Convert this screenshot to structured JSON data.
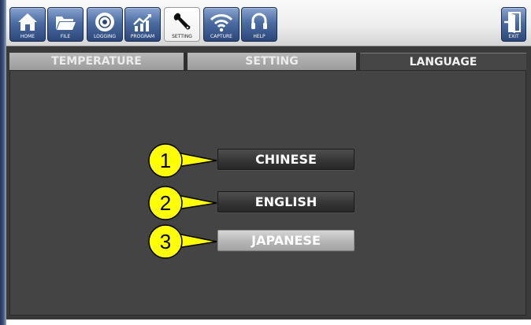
{
  "toolbar": {
    "buttons": [
      {
        "label": "HOME",
        "icon": "home-icon"
      },
      {
        "label": "FILE",
        "icon": "folder-icon"
      },
      {
        "label": "LOGGING",
        "icon": "disc-icon"
      },
      {
        "label": "PROGRAM",
        "icon": "chart-icon"
      },
      {
        "label": "SETTING",
        "icon": "wrench-icon",
        "active": true
      },
      {
        "label": "CAPTURE",
        "icon": "wifi-icon"
      },
      {
        "label": "HELP",
        "icon": "headset-icon"
      }
    ],
    "exit": {
      "label": "EXIT",
      "icon": "exit-door-icon"
    }
  },
  "tabs": [
    {
      "label": "TEMPERATURE",
      "selected": false
    },
    {
      "label": "SETTING",
      "selected": false
    },
    {
      "label": "LANGUAGE",
      "selected": true
    }
  ],
  "languages": [
    {
      "label": "CHINESE",
      "selected": false
    },
    {
      "label": "ENGLISH",
      "selected": false
    },
    {
      "label": "JAPANESE",
      "selected": true
    }
  ],
  "callouts": [
    "1",
    "2",
    "3"
  ],
  "colors": {
    "toolbar_button": "#4b6ca2",
    "panel_background": "#444444",
    "callout_fill": "#ffff00",
    "selected_button": "#b6b6b6"
  }
}
